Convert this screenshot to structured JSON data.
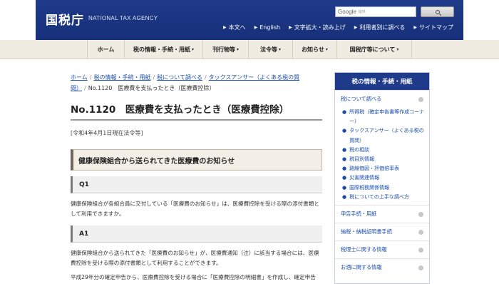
{
  "header": {
    "logo": "国税庁",
    "logo_en": "NATIONAL TAX AGENCY",
    "search_google": "Google",
    "search_sub": "提供",
    "util_links": [
      "本文へ",
      "English",
      "文字拡大・読み上げ",
      "利用者別に調べる",
      "サイトマップ"
    ]
  },
  "gnav": {
    "items": [
      "ホーム",
      "税の情報・手続・用紙",
      "刊行物等",
      "法令等",
      "お知らせ",
      "国税庁等について"
    ]
  },
  "breadcrumb": {
    "items": [
      "ホーム",
      "税の情報・手続・用紙",
      "税について調べる",
      "タックスアンサー（よくある税の質問）"
    ],
    "current": "No.1120　医療費を支払ったとき（医療費控除）"
  },
  "main": {
    "title": "No.1120　医療費を支払ったとき（医療費控除）",
    "law_date": "[令和4年4月1日現在法令等]",
    "section_heading": "健康保険組合から送られてきた医療費のお知らせ",
    "q1_label": "Q1",
    "q1_text_1": "健康保険組合が各組合員に交付している「医療費のお知らせ」は、医療費控除を受ける際の添付書類と",
    "q1_text_2": "して利用できますか。",
    "a1_label": "A1",
    "a1_text_1": "健康保険組合から送られてきた「医療費のお知らせ」が、医療費通知（注）に該当する場合には、医療",
    "a1_text_2": "費控除を受ける際の添付書類として利用することができます。",
    "a1_text_3": "平成29年分の確定申告から、医療費控除を受ける場合に「医療費控除の明細書」を作成し、確定申告"
  },
  "sidebar": {
    "title": "税の情報・手続・用紙",
    "top_cat": "税について調べる",
    "sub_items": [
      "所得税（確定申告書等作成コーナー）",
      "タックスアンサー（よくある税の質問）",
      "税の相談",
      "税目別情報",
      "路線価図・評価倍率表",
      "災害関連情報",
      "国際税務関係情報",
      "税についての上手な調べ方"
    ],
    "cats": [
      "申告手続・用紙",
      "納税・納税証明書手続",
      "税理士に関する情報",
      "お酒に関する情報"
    ]
  }
}
